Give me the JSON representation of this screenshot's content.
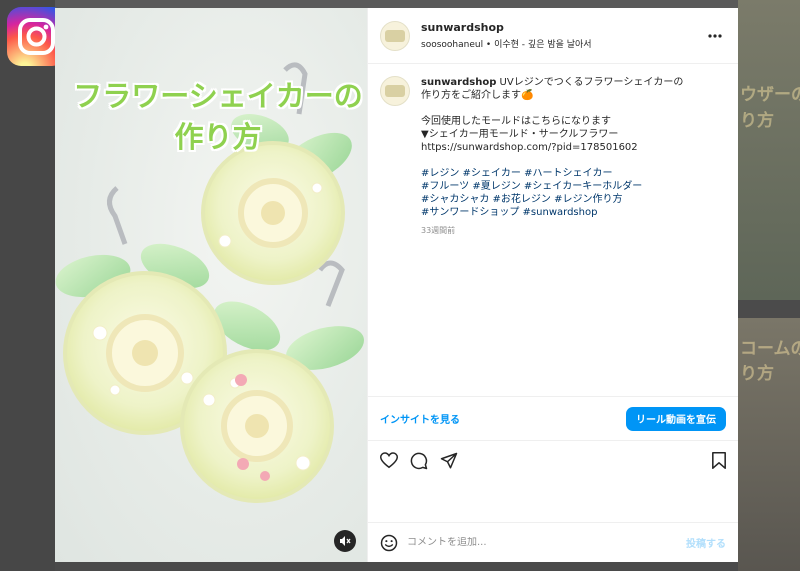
{
  "app": {
    "icon": "instagram-icon"
  },
  "background": {
    "text_top": "ウザーの",
    "text_top2": "り方",
    "text_bottom": "コームの",
    "text_bottom2": "り方"
  },
  "media": {
    "overlay_title_line1": "フラワーシェイカーの",
    "overlay_title_line2": "作り方",
    "mute_icon": "volume-muted-icon"
  },
  "header": {
    "username": "sunwardshop",
    "audio": "soosoohaneul • 이수현 - 깊은 밤을 날아서",
    "more_icon": "more-horizontal-icon"
  },
  "caption": {
    "username": "sunwardshop",
    "line1": " UVレジンでつくるフラワーシェイカーの",
    "line2": "作り方をご紹介します🍊",
    "line3": "今回使用したモールドはこちらになります",
    "line4": "▼シェイカー用モールド・サークルフラワー",
    "line5": "https://sunwardshop.com/?pid=178501602",
    "hashtags": [
      "#レジン #シェイカー #ハートシェイカー",
      "#フルーツ #夏レジン #シェイカーキーホルダー",
      "#シャカシャカ #お花レジン #レジン作り方",
      "#サンワードショップ #sunwardshop"
    ],
    "time_ago": "33週間前"
  },
  "insights": {
    "link": "インサイトを見る",
    "promote_button": "リール動画を宣伝"
  },
  "actions": [
    "heart-icon",
    "comment-icon",
    "share-icon",
    "bookmark-icon"
  ],
  "comment": {
    "placeholder": "コメントを追加...",
    "post_label": "投稿する",
    "emoji_icon": "emoji-icon"
  },
  "colors": {
    "accent": "#0095f6",
    "title_green": "#8fd14f"
  }
}
